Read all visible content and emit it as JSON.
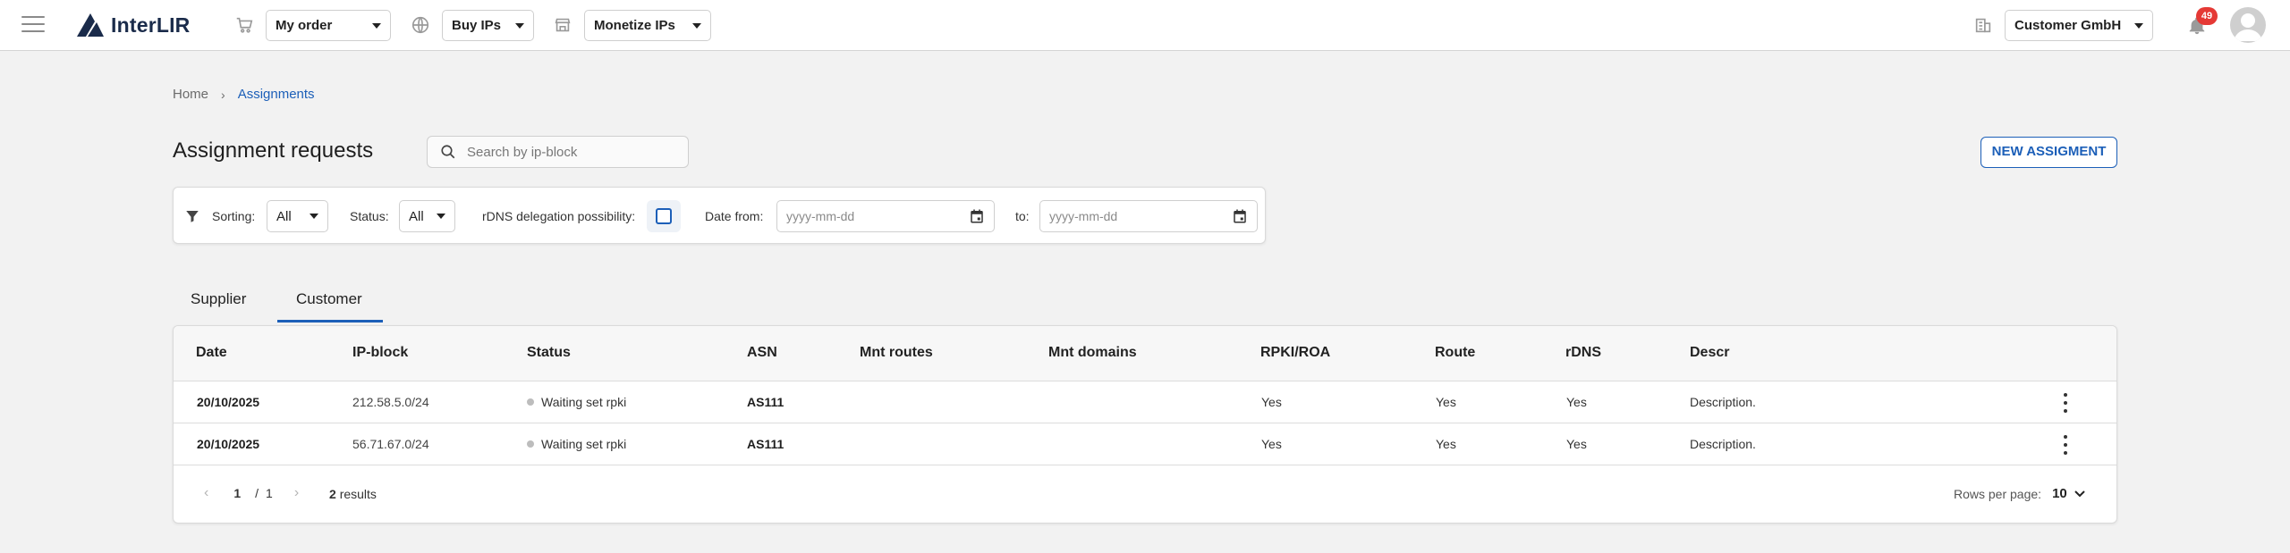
{
  "topbar": {
    "logo_text": "InterLIR",
    "nav": {
      "my_order": "My order",
      "buy_ips": "Buy IPs",
      "monetize_ips": "Monetize IPs"
    },
    "company": "Customer GmbH",
    "notifications_count": "49"
  },
  "breadcrumb": {
    "home": "Home",
    "separator": "›",
    "current": "Assignments"
  },
  "page": {
    "title": "Assignment requests",
    "search_placeholder": "Search by ip-block",
    "new_button": "NEW ASSIGMENT"
  },
  "filters": {
    "sorting_label": "Sorting:",
    "sorting_value": "All",
    "status_label": "Status:",
    "status_value": "All",
    "rdns_label": "rDNS delegation possibility:",
    "date_from_label": "Date from:",
    "date_from_placeholder": "yyyy-mm-dd",
    "date_to_label": "to:",
    "date_to_placeholder": "yyyy-mm-dd"
  },
  "tabs": [
    {
      "label": "Supplier",
      "active": false
    },
    {
      "label": "Customer",
      "active": true
    }
  ],
  "table": {
    "headers": [
      "Date",
      "IP-block",
      "Status",
      "ASN",
      "Mnt routes",
      "Mnt domains",
      "RPKI/ROA",
      "Route",
      "rDNS",
      "Descr"
    ],
    "rows": [
      {
        "date": "20/10/2025",
        "ip_block": "212.58.5.0/24",
        "status": "Waiting set rpki",
        "asn": "AS111",
        "mnt_routes": "",
        "mnt_domains": "",
        "rpki": "Yes",
        "route": "Yes",
        "rdns": "Yes",
        "descr": "Description."
      },
      {
        "date": "20/10/2025",
        "ip_block": "56.71.67.0/24",
        "status": "Waiting set rpki",
        "asn": "AS111",
        "mnt_routes": "",
        "mnt_domains": "",
        "rpki": "Yes",
        "route": "Yes",
        "rdns": "Yes",
        "descr": "Description."
      }
    ]
  },
  "pagination": {
    "current_page": "1",
    "separator": "/",
    "total_pages": "1",
    "results_count": "2",
    "results_label": "results",
    "rows_per_page_label": "Rows per page:",
    "rows_per_page_value": "10"
  },
  "colors": {
    "accent": "#1c5fb8",
    "badge": "#e53935",
    "background": "#f2f2f2"
  }
}
